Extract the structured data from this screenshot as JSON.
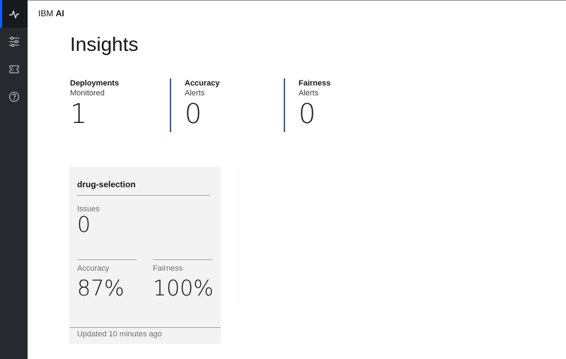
{
  "app": {
    "brand_prefix": "IBM",
    "brand_name": "AI"
  },
  "sidebar": {
    "items": [
      {
        "icon": "activity-icon",
        "active": true
      },
      {
        "icon": "settings-adjust-icon",
        "active": false
      },
      {
        "icon": "ticket-icon",
        "active": false
      },
      {
        "icon": "help-icon",
        "active": false
      }
    ]
  },
  "page": {
    "title": "Insights"
  },
  "metrics": [
    {
      "title": "Deployments",
      "subtitle": "Monitored",
      "value": "1"
    },
    {
      "title": "Accuracy",
      "subtitle": "Alerts",
      "value": "0"
    },
    {
      "title": "Fairness",
      "subtitle": "Alerts",
      "value": "0"
    }
  ],
  "deployment_card": {
    "name": "drug-selection",
    "issues_label": "Issues",
    "issues_value": "0",
    "accuracy_label": "Accuracy",
    "accuracy_value": "87%",
    "fairness_label": "Fairness",
    "fairness_value": "100%",
    "footer": "Updated 10 minutes ago"
  },
  "colors": {
    "sidebar_bg": "#262a2e",
    "accent": "#0f62fe",
    "divider": "#3a5aa0",
    "card_bg": "#f3f3f3"
  }
}
